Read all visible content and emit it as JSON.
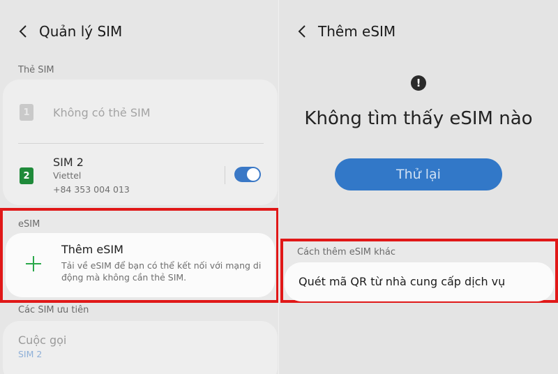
{
  "left": {
    "title": "Quản lý SIM",
    "sim_section": "Thẻ SIM",
    "sim1_label": "Không có thẻ SIM",
    "sim1_badge": "1",
    "sim2_name": "SIM 2",
    "sim2_badge": "2",
    "sim2_carrier": "Viettel",
    "sim2_number": "+84 353 004 013",
    "sim2_enabled": true,
    "esim_section": "eSIM",
    "add_esim_title": "Thêm eSIM",
    "add_esim_desc": "Tải về eSIM để bạn có thể kết nối với mạng di động mà không cần thẻ SIM.",
    "pref_section": "Các SIM ưu tiên",
    "calls_label": "Cuộc gọi",
    "calls_value": "SIM 2"
  },
  "right": {
    "title": "Thêm eSIM",
    "warning_glyph": "!",
    "message": "Không tìm thấy eSIM nào",
    "retry_label": "Thử lại",
    "other_section": "Cách thêm eSIM khác",
    "qr_option": "Quét mã QR từ nhà cung cấp dịch vụ"
  },
  "colors": {
    "highlight": "#e01818",
    "accent": "#3278c8",
    "sim_badge": "#1f8a3a",
    "plus": "#2aa84a"
  }
}
